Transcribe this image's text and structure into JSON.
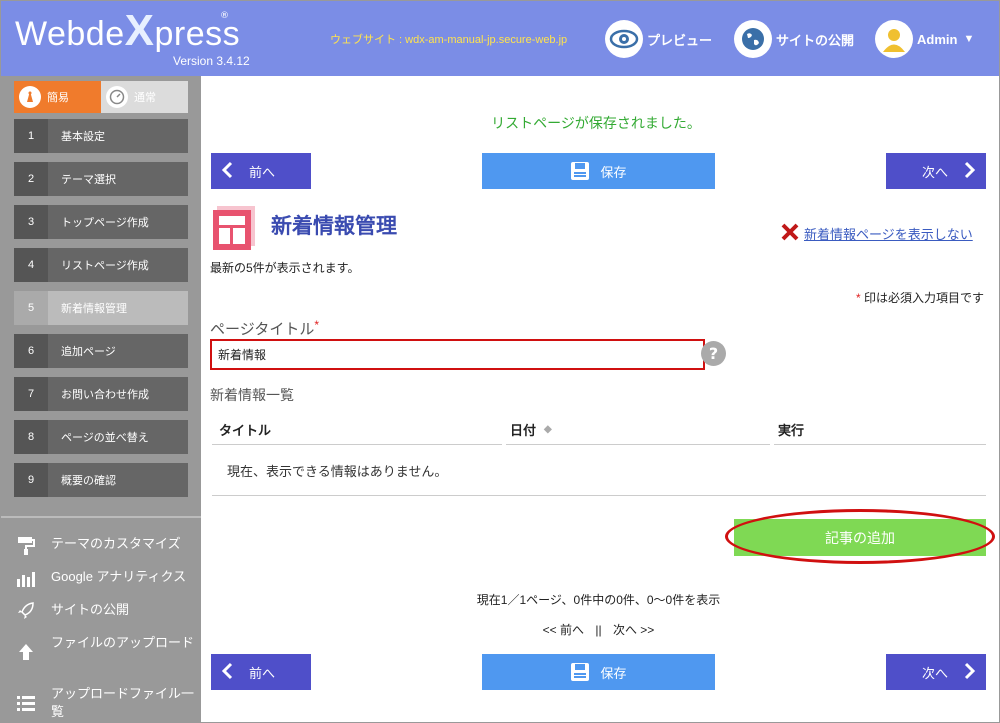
{
  "header": {
    "logo_text_1": "Webde",
    "logo_x": "X",
    "logo_text_2": "press",
    "logo_reg": "®",
    "version": "Version 3.4.12",
    "site_url": "ウェブサイト : wdx-am-manual-jp.secure-web.jp",
    "preview_label": "プレビュー",
    "publish_label": "サイトの公開",
    "admin_label": "Admin"
  },
  "sidebar": {
    "mode_simple": "簡易",
    "mode_normal": "通常",
    "steps": [
      {
        "num": "1",
        "label": "基本設定"
      },
      {
        "num": "2",
        "label": "テーマ選択"
      },
      {
        "num": "3",
        "label": "トップページ作成"
      },
      {
        "num": "4",
        "label": "リストページ作成"
      },
      {
        "num": "5",
        "label": "新着情報管理"
      },
      {
        "num": "6",
        "label": "追加ページ"
      },
      {
        "num": "7",
        "label": "お問い合わせ作成"
      },
      {
        "num": "8",
        "label": "ページの並べ替え"
      },
      {
        "num": "9",
        "label": "概要の確認"
      }
    ],
    "active_step": "5",
    "links": [
      {
        "label": "テーマのカスタマイズ",
        "icon": "paint-roller-icon"
      },
      {
        "label": "Google アナリティクス",
        "icon": "bar-chart-icon"
      },
      {
        "label": "サイトの公開",
        "icon": "rocket-icon"
      },
      {
        "label": "ファイルのアップロード",
        "icon": "upload-icon"
      },
      {
        "label": "アップロードファイル一覧",
        "icon": "list-icon"
      }
    ]
  },
  "main": {
    "saved_message": "リストページが保存されました。",
    "prev_label": "前へ",
    "save_label": "保存",
    "next_label": "次へ",
    "section_title": "新着情報管理",
    "hide_link": "新着情報ページを表示しない",
    "latest_note": "最新の5件が表示されます。",
    "required_ast": "*",
    "required_note": " 印は必須入力項目です",
    "page_title_label": "ページタイトル",
    "page_title_value": "新着情報",
    "help_symbol": "?",
    "list_label": "新着情報一覧",
    "table_headers": {
      "title": "タイトル",
      "date": "日付",
      "action": "実行"
    },
    "empty_message": "現在、表示できる情報はありません。",
    "add_button": "記事の追加",
    "paging_info": "現在1／1ページ、0件中の0件、0～0件を表示",
    "paging_prev": "<< 前へ",
    "paging_sep": "||",
    "paging_next": "次へ >>"
  },
  "colors": {
    "header_bg": "#7b8de6",
    "nav_button": "#4f4fc9",
    "save_button": "#4f98f0",
    "add_button": "#7fd954",
    "highlight_red": "#d01010"
  }
}
